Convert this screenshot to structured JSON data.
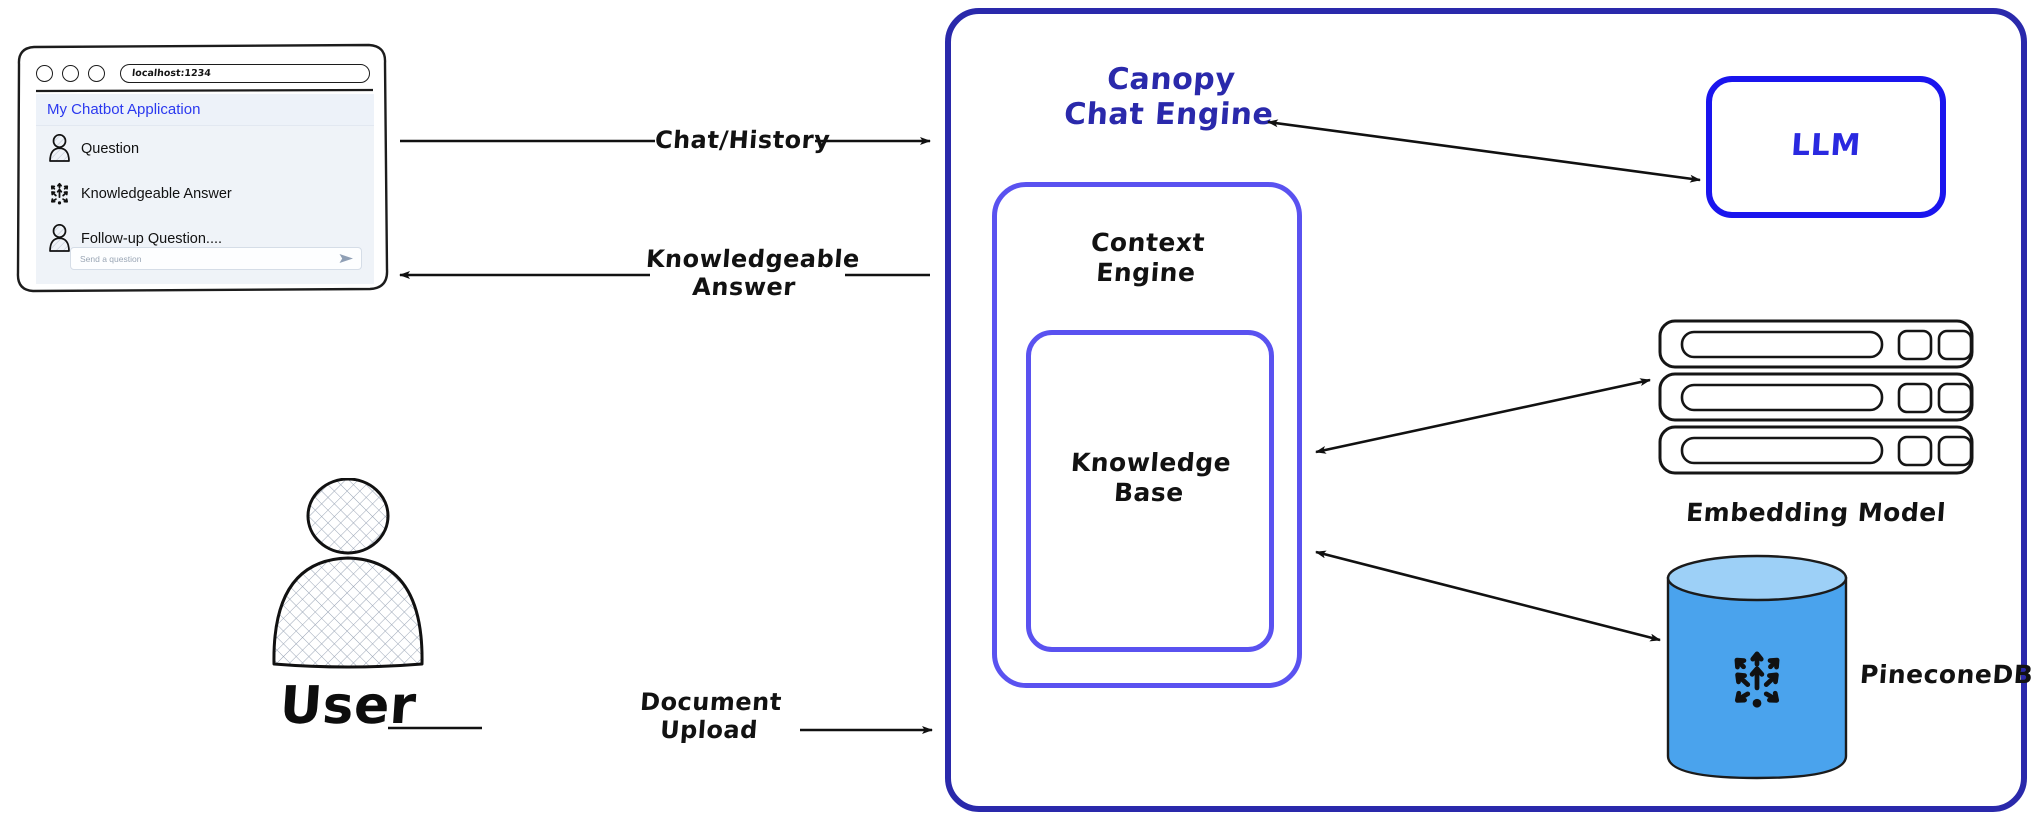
{
  "browser": {
    "url": "localhost:1234",
    "app_title": "My Chatbot Application",
    "traffic_lights": [
      "close-dot",
      "minimize-dot",
      "maximize-dot"
    ],
    "messages": [
      {
        "role": "user",
        "icon": "user-avatar-icon",
        "text": "Question"
      },
      {
        "role": "assistant",
        "icon": "pinecone-vector-icon",
        "text": "Knowledgeable Answer"
      },
      {
        "role": "user",
        "icon": "user-avatar-icon",
        "text": "Follow-up Question...."
      }
    ],
    "composer": {
      "placeholder": "Send a question",
      "send_icon": "send-paper-plane-icon"
    }
  },
  "actor": {
    "label": "User",
    "icon": "user-person-icon"
  },
  "flows": [
    {
      "id": "chat-history",
      "label": "Chat/History",
      "direction": "right"
    },
    {
      "id": "knowledgeable-answer",
      "label": "Knowledgeable\nAnswer",
      "direction": "left"
    },
    {
      "id": "document-upload",
      "label": "Document\nUpload",
      "direction": "right"
    }
  ],
  "canopy": {
    "title": "Canopy\nChat Engine",
    "border_color": "#2a29ab",
    "title_color": "#2a29ab",
    "context_engine": {
      "label": "Context\nEngine",
      "border_color": "#5a52f0",
      "knowledge_base": {
        "label": "Knowledge\nBase",
        "border_color": "#5a52f0"
      }
    }
  },
  "services": {
    "llm": {
      "label": "LLM",
      "border_color": "#1a15ee",
      "text_color": "#2a29e0",
      "icon": "rounded-box"
    },
    "embedding_model": {
      "label": "Embedding Model",
      "icon": "server-rack-icon",
      "rack_count": 3
    },
    "pinecone": {
      "label": "PineconeDB",
      "icon": "database-cylinder-icon",
      "body_color": "#4aa3ed",
      "top_color": "#9dd0f7",
      "logo": "pinecone-vector-icon"
    }
  },
  "connections": [
    {
      "from": "canopy-chat-engine",
      "to": "llm",
      "direction": "bidirectional"
    },
    {
      "from": "context-engine",
      "to": "embedding-model",
      "direction": "bidirectional"
    },
    {
      "from": "context-engine",
      "to": "pinecone-db",
      "direction": "bidirectional"
    }
  ]
}
